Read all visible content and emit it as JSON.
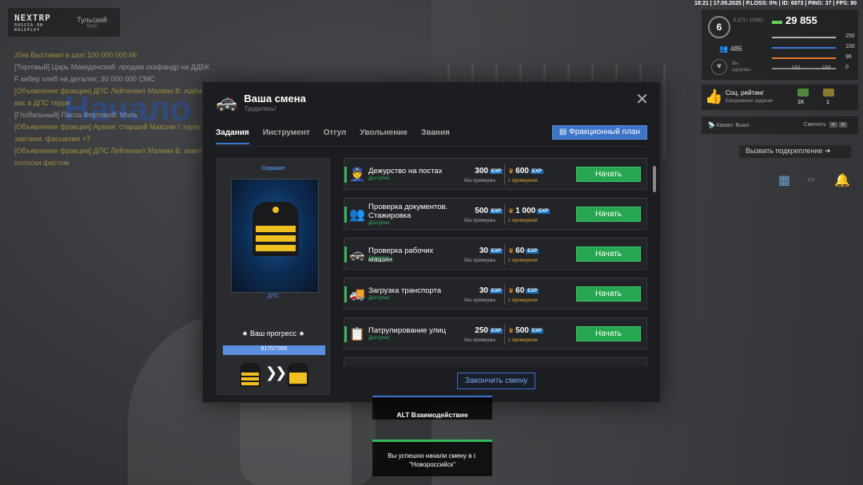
{
  "topbar": {
    "status": "18:21 | 17.05.2025 | P.LOSS: 0% | ID: 6973 | PING: 37 | FPS: 90"
  },
  "logo": {
    "name": "NEXTRP",
    "sub": "RUSSIA ON ROLEPLAY",
    "city": "Тульский",
    "city_sub": "Край"
  },
  "chat": [
    {
      "text": "20кк Выставил в шоп 100 000 000 Мг",
      "style": "y"
    },
    {
      "text": "[Торговый] Царь Македонский: продам скафандр на ДДБК F кибер хлеб на деталях; 30 000 000 СМС",
      "style": ""
    },
    {
      "text": "[Объявление фракции] ДПС Лейтенант Малкин В: ждём вас в ДПС терри",
      "style": "y"
    },
    {
      "text": "[Глобальный] Пасха Фортовой: Моль",
      "style": ""
    },
    {
      "text": "[Объявление фракции] Армия: старший Максим I: гарку завтаем. фасыкоме +7",
      "style": "y"
    },
    {
      "text": "[Объявление фракции] ДПС Лейтенант Малкин В: завет 2 полоски фастом",
      "style": "y"
    }
  ],
  "background_title": "Начало",
  "hud": {
    "level": "6",
    "level_xp": "6,373 / 10000",
    "money": "29 855",
    "online": "486",
    "health_label": "Вы здоровы",
    "stats": [
      {
        "value": "250",
        "color": "#b0b0b0"
      },
      {
        "value": "100",
        "color": "#3a78d4"
      },
      {
        "value": "96",
        "color": "#e07a30"
      },
      {
        "value": "0",
        "color": "#888888"
      }
    ],
    "mini_left": "183",
    "mini_right": "188",
    "rating_title": "Соц. рейтинг",
    "rating_sub": "Ежедневное задание",
    "rating_1k": "1K",
    "rating_1": "1",
    "channel": "Канал: Выкл.",
    "channel_action": "Сменить",
    "channel_keys": [
      "<",
      ">"
    ],
    "backup": "Вызвать подкрепление"
  },
  "modal": {
    "title": "Ваша смена",
    "subtitle": "Трудитесь!",
    "tabs": [
      "Задания",
      "Инструмент",
      "Отгул",
      "Увольнение",
      "Звания"
    ],
    "active_tab": 0,
    "plan_button": "Фракционный план",
    "end_button": "Закончить смену",
    "rank": {
      "name": "Сержант",
      "department": "ДПС",
      "progress_label": "Ваш прогресс",
      "progress_text": "8170/7000",
      "progress_fraction": 1.0
    },
    "tasks": [
      {
        "name": "Дежурство на постах",
        "status": "Доступно",
        "icon": "👮",
        "exp": "300",
        "exp_premium": "600",
        "label": "без премиума",
        "label_premium": "с премиумом",
        "button": "Начать"
      },
      {
        "name": "Проверка документов. Стажировка",
        "status": "Доступно",
        "icon": "👥",
        "exp": "500",
        "exp_premium": "1 000",
        "label": "без премиума",
        "label_premium": "с премиумом",
        "button": "Начать"
      },
      {
        "name": "Проверка рабочих машин",
        "status": "Доступно",
        "icon": "🚓",
        "exp": "30",
        "exp_premium": "60",
        "label": "без премиума",
        "label_premium": "с премиумом",
        "button": "Начать"
      },
      {
        "name": "Загрузка транспорта",
        "status": "Доступно",
        "icon": "🚚",
        "exp": "30",
        "exp_premium": "60",
        "label": "без премиума",
        "label_premium": "с премиумом",
        "button": "Начать"
      },
      {
        "name": "Патрулирование улиц",
        "status": "Доступно",
        "icon": "📋",
        "exp": "250",
        "exp_premium": "500",
        "label": "без премиума",
        "label_premium": "с премиумом",
        "button": "Начать"
      }
    ],
    "exp_tag": "EXP"
  },
  "alt_hint": "ALT Взаимодействие",
  "notification": "Вы успешно начали смену в г. \"Новороссийск\""
}
